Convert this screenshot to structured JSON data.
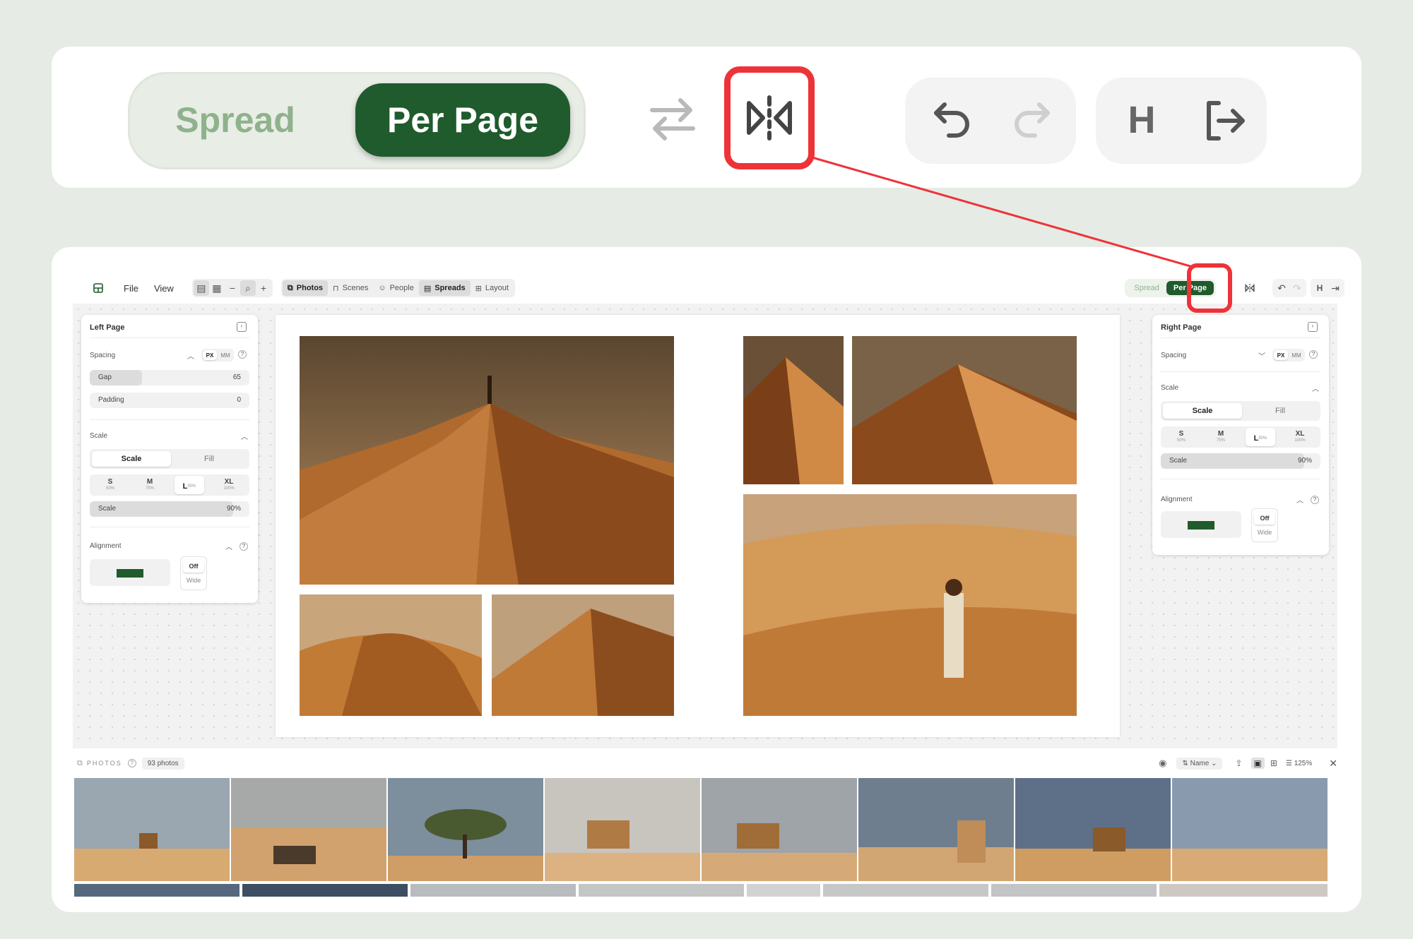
{
  "zoom": {
    "spread_label": "Spread",
    "perpage_label": "Per Page",
    "history_icons": [
      "undo-icon",
      "redo-icon"
    ],
    "misc": {
      "h_label": "H",
      "exit_icon": "exit-icon"
    },
    "accent": "#1f5b2c",
    "highlight": "#ee3338"
  },
  "toolbar": {
    "menu": [
      "File",
      "View"
    ],
    "tabs": [
      {
        "label": "Photos",
        "icon": "photos-icon",
        "active": true
      },
      {
        "label": "Scenes",
        "icon": "book-icon",
        "active": false
      },
      {
        "label": "People",
        "icon": "people-icon",
        "active": false
      },
      {
        "label": "Spreads",
        "icon": "spreads-icon",
        "active": true
      },
      {
        "label": "Layout",
        "icon": "layout-icon",
        "active": false
      }
    ],
    "spread_label": "Spread",
    "perpage_label": "Per Page",
    "h_label": "H"
  },
  "left_panel": {
    "title": "Left Page",
    "spacing": {
      "label": "Spacing",
      "unit_px": "PX",
      "unit_mm": "MM",
      "gap": {
        "label": "Gap",
        "value": "65"
      },
      "padding": {
        "label": "Padding",
        "value": "0"
      }
    },
    "scale": {
      "label": "Scale",
      "mode_scale": "Scale",
      "mode_fill": "Fill",
      "sizes": [
        {
          "code": "S",
          "pct": "50%"
        },
        {
          "code": "M",
          "pct": "75%"
        },
        {
          "code": "L",
          "pct": "90%"
        },
        {
          "code": "XL",
          "pct": "100%"
        }
      ],
      "slider_label": "Scale",
      "slider_value": "90%",
      "slider_fraction": 0.9
    },
    "alignment": {
      "label": "Alignment",
      "off": "Off",
      "wide": "Wide"
    }
  },
  "right_panel": {
    "title": "Right Page",
    "spacing": {
      "label": "Spacing",
      "unit_px": "PX",
      "unit_mm": "MM"
    },
    "scale": {
      "label": "Scale",
      "mode_scale": "Scale",
      "mode_fill": "Fill",
      "sizes": [
        {
          "code": "S",
          "pct": "50%"
        },
        {
          "code": "M",
          "pct": "75%"
        },
        {
          "code": "L",
          "pct": "90%"
        },
        {
          "code": "XL",
          "pct": "100%"
        }
      ],
      "slider_label": "Scale",
      "slider_value": "90%",
      "slider_fraction": 0.9
    },
    "alignment": {
      "label": "Alignment",
      "off": "Off",
      "wide": "Wide"
    }
  },
  "photos_bar": {
    "label": "PHOTOS",
    "count": "93 photos",
    "sort_label": "Name",
    "zoom": "125%"
  }
}
